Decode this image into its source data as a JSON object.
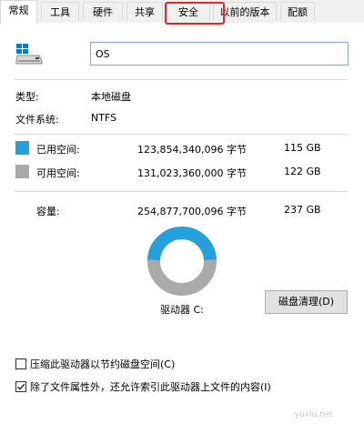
{
  "tabs": [
    {
      "label": "常规",
      "active": true
    },
    {
      "label": "工具",
      "active": false
    },
    {
      "label": "硬件",
      "active": false
    },
    {
      "label": "共享",
      "active": false
    },
    {
      "label": "安全",
      "active": false,
      "highlighted": true
    },
    {
      "label": "以前的版本",
      "active": false
    },
    {
      "label": "配额",
      "active": false
    }
  ],
  "drive": {
    "icon": "drive-icon",
    "name_value": "OS"
  },
  "info": {
    "type_label": "类型:",
    "type_value": "本地磁盘",
    "fs_label": "文件系统:",
    "fs_value": "NTFS"
  },
  "space": {
    "used": {
      "label": "已用空间:",
      "bytes": "123,854,340,096 字节",
      "size": "115 GB",
      "color": "#26a0da"
    },
    "free": {
      "label": "可用空间:",
      "bytes": "131,023,360,000 字节",
      "size": "122 GB",
      "color": "#aaaaaa"
    },
    "capacity": {
      "label": "容量:",
      "bytes": "254,877,700,096 字节",
      "size": "237 GB"
    },
    "used_fraction": 0.486
  },
  "drive_label": "驱动器 C:",
  "cleanup_button": "磁盘清理(D)",
  "options": {
    "compress": {
      "label": "压缩此驱动器以节约磁盘空间(C)",
      "checked": false
    },
    "index": {
      "label": "除了文件属性外，还允许索引此驱动器上文件的内容(I)",
      "checked": true
    }
  },
  "watermark": "yuxiu.net"
}
